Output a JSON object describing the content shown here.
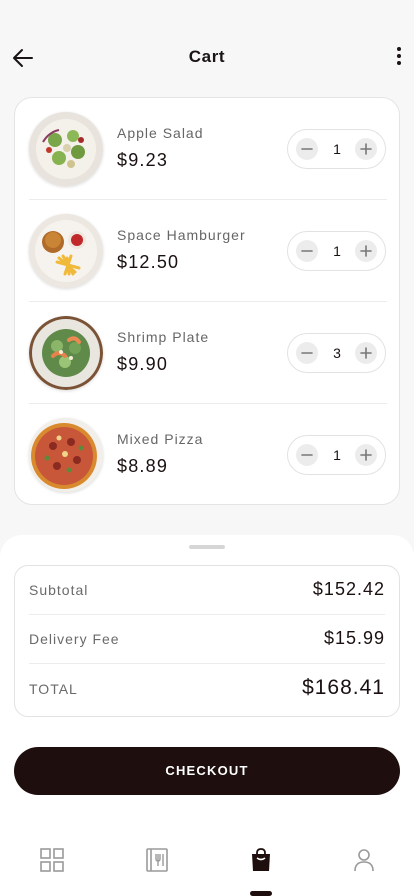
{
  "header": {
    "title": "Cart",
    "back_icon": "arrow-left-icon",
    "more_icon": "more-vertical-icon"
  },
  "cart": {
    "items": [
      {
        "name": "Apple Salad",
        "price": "$9.23",
        "quantity": "1",
        "image": "salad-image"
      },
      {
        "name": "Space Hamburger",
        "price": "$12.50",
        "quantity": "1",
        "image": "burger-image"
      },
      {
        "name": "Shrimp Plate",
        "price": "$9.90",
        "quantity": "3",
        "image": "shrimp-plate-image"
      },
      {
        "name": "Mixed Pizza",
        "price": "$8.89",
        "quantity": "1",
        "image": "pizza-image"
      }
    ],
    "minus_icon": "minus-icon",
    "plus_icon": "plus-icon"
  },
  "summary": {
    "subtotal_label": "Subtotal",
    "subtotal_value": "$152.42",
    "delivery_label": "Delivery Fee",
    "delivery_value": "$15.99",
    "total_label": "TOTAL",
    "total_value": "$168.41"
  },
  "checkout": {
    "label": "CHECKOUT"
  },
  "tabbar": {
    "tabs": [
      {
        "icon": "grid-icon",
        "active": false
      },
      {
        "icon": "menu-book-icon",
        "active": false
      },
      {
        "icon": "shopping-bag-icon",
        "active": true
      },
      {
        "icon": "user-icon",
        "active": false
      }
    ]
  },
  "colors": {
    "accent": "#1e0e0e",
    "background": "#f7f7f7",
    "card": "#ffffff",
    "muted_text": "#666666"
  }
}
